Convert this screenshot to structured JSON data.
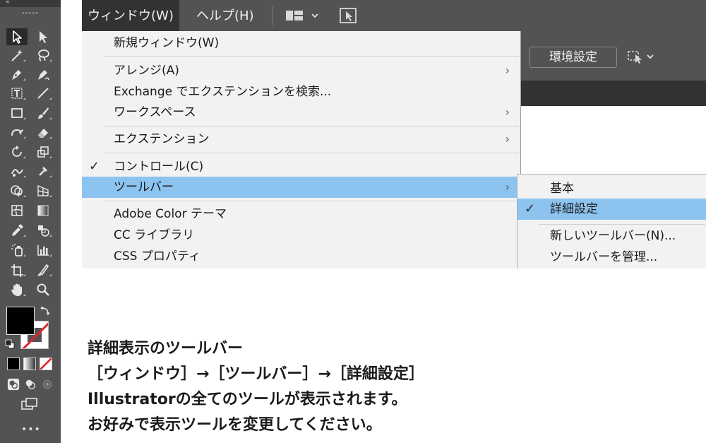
{
  "menubar": {
    "items": [
      "ウィンドウ(W)",
      "ヘルプ(H)"
    ],
    "icons": [
      "workspace-layout-icon",
      "chevron-down-icon",
      "arrange-documents-icon"
    ]
  },
  "control": {
    "preferences_label": "環境設定",
    "icons": [
      "panel-arrange-icon",
      "chevron-down-icon"
    ]
  },
  "window_menu": {
    "items": [
      {
        "label": "新規ウィンドウ(W)",
        "has_submenu": false,
        "checked": false,
        "highlighted": false
      },
      {
        "label": "アレンジ(A)",
        "has_submenu": true,
        "checked": false,
        "highlighted": false
      },
      {
        "label": "Exchange でエクステンションを検索...",
        "has_submenu": false,
        "checked": false,
        "highlighted": false
      },
      {
        "label": "ワークスペース",
        "has_submenu": true,
        "checked": false,
        "highlighted": false
      },
      {
        "label": "エクステンション",
        "has_submenu": true,
        "checked": false,
        "highlighted": false
      },
      {
        "label": "コントロール(C)",
        "has_submenu": false,
        "checked": true,
        "highlighted": false
      },
      {
        "label": "ツールバー",
        "has_submenu": true,
        "checked": false,
        "highlighted": true
      },
      {
        "label": "Adobe Color テーマ",
        "has_submenu": false,
        "checked": false,
        "highlighted": false
      },
      {
        "label": "CC ライブラリ",
        "has_submenu": false,
        "checked": false,
        "highlighted": false
      },
      {
        "label": "CSS プロパティ",
        "has_submenu": false,
        "checked": false,
        "highlighted": false
      }
    ],
    "check_glyph": "✓",
    "chevron_glyph": "›"
  },
  "toolbar_submenu": {
    "items": [
      {
        "label": "基本",
        "checked": false,
        "highlighted": false
      },
      {
        "label": "詳細設定",
        "checked": true,
        "highlighted": true
      },
      {
        "label": "新しいツールバー(N)...",
        "checked": false,
        "highlighted": false
      },
      {
        "label": "ツールバーを管理...",
        "checked": false,
        "highlighted": false
      }
    ]
  },
  "tools_panel": {
    "collapse_glyph": "«",
    "more_glyph": "•••",
    "tools": [
      "selection-icon",
      "direct-selection-icon",
      "magic-wand-icon",
      "lasso-icon",
      "pen-icon",
      "curvature-icon",
      "type-icon",
      "line-icon",
      "rectangle-icon",
      "paintbrush-icon",
      "shaper-icon",
      "eraser-icon",
      "rotate-icon",
      "scale-icon",
      "puppet-warp-icon",
      "symbol-sprayer-icon",
      "shape-builder-icon",
      "perspective-grid-icon",
      "mesh-icon",
      "gradient-icon",
      "eyedropper-icon",
      "blend-icon",
      "symbol-sprayer-2-icon",
      "column-graph-icon",
      "artboard-icon",
      "slice-icon",
      "hand-icon",
      "zoom-icon"
    ],
    "fill_color": "#000000",
    "stroke_color": "none"
  },
  "caption": {
    "lines": [
      "詳細表示のツールバー",
      "［ウィンドウ］→［ツールバー］→［詳細設定］",
      "Illustratorの全てのツールが表示されます。",
      "お好みで表示ツールを変更してください。"
    ]
  },
  "colors": {
    "panel_gray": "#535353",
    "menu_bg": "#f2f2f2",
    "highlight_blue": "#8cc3ef",
    "menubar_active": "#323232"
  }
}
